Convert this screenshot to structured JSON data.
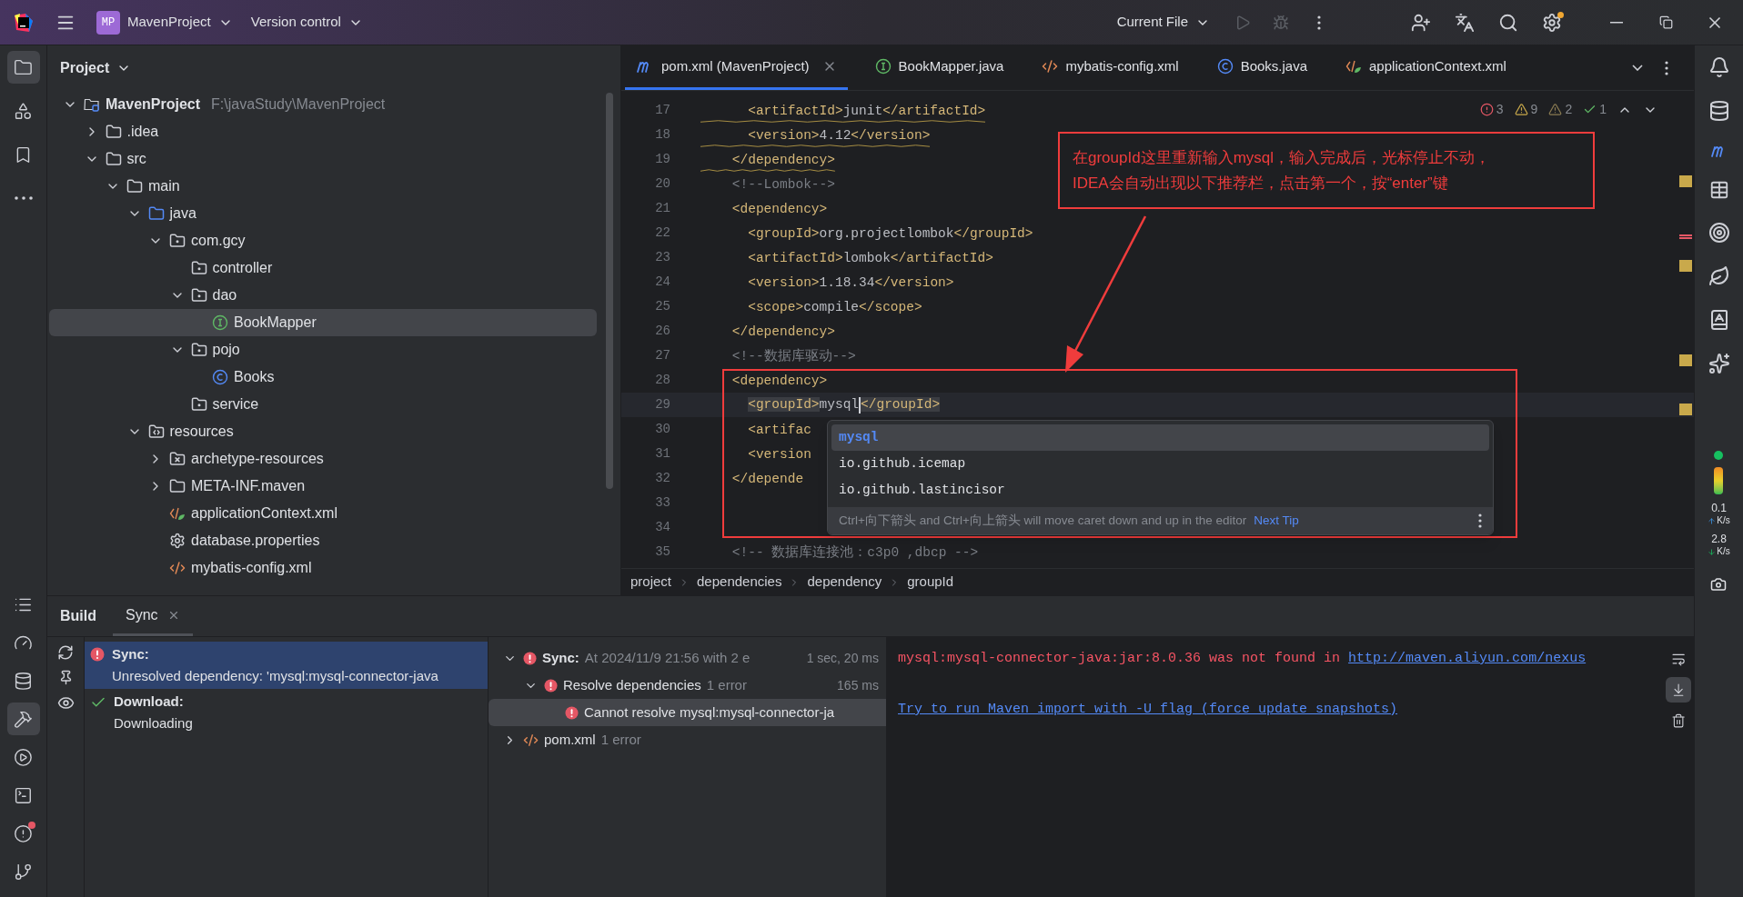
{
  "title_bar": {
    "project_badge": "MP",
    "project": "MavenProject",
    "vcs": "Version control",
    "run_config": "Current File"
  },
  "left_tools": [
    {
      "kind": "project",
      "selected": true,
      "alert": false
    },
    {
      "kind": "structure",
      "selected": false,
      "alert": false
    },
    {
      "kind": "bookmarks",
      "selected": false,
      "alert": false
    },
    {
      "kind": "more",
      "selected": false,
      "alert": false
    }
  ],
  "left_tools_bottom": [
    {
      "kind": "todo",
      "selected": false,
      "alert": false
    },
    {
      "kind": "profiler",
      "selected": false,
      "alert": false
    },
    {
      "kind": "database",
      "selected": false,
      "alert": false
    },
    {
      "kind": "build",
      "selected": true,
      "alert": false
    },
    {
      "kind": "services",
      "selected": false,
      "alert": false
    },
    {
      "kind": "terminal",
      "selected": false,
      "alert": false
    },
    {
      "kind": "problems",
      "selected": false,
      "alert": true
    },
    {
      "kind": "git",
      "selected": false,
      "alert": false
    }
  ],
  "project_panel": {
    "title": "Project",
    "tree": [
      {
        "label": "MavenProject",
        "hint": "F:\\javaStudy\\MavenProject",
        "kind": "module",
        "expanded": true,
        "selected": false,
        "children": [
          {
            "label": ".idea",
            "kind": "folder",
            "expanded": false,
            "selected": false
          },
          {
            "label": "src",
            "kind": "folder",
            "expanded": true,
            "selected": false,
            "children": [
              {
                "label": "main",
                "kind": "folder",
                "expanded": true,
                "selected": false,
                "children": [
                  {
                    "label": "java",
                    "kind": "source",
                    "expanded": true,
                    "selected": false,
                    "children": [
                      {
                        "label": "com.gcy",
                        "kind": "package",
                        "expanded": true,
                        "selected": false,
                        "children": [
                          {
                            "label": "controller",
                            "kind": "package",
                            "selected": false
                          },
                          {
                            "label": "dao",
                            "kind": "package",
                            "expanded": true,
                            "selected": false,
                            "children": [
                              {
                                "label": "BookMapper",
                                "kind": "interface",
                                "selected": true
                              }
                            ]
                          },
                          {
                            "label": "pojo",
                            "kind": "package",
                            "expanded": true,
                            "selected": false,
                            "children": [
                              {
                                "label": "Books",
                                "kind": "class",
                                "selected": false
                              }
                            ]
                          },
                          {
                            "label": "service",
                            "kind": "package",
                            "selected": false
                          }
                        ]
                      }
                    ]
                  },
                  {
                    "label": "resources",
                    "kind": "resources",
                    "expanded": true,
                    "selected": false,
                    "children": [
                      {
                        "label": "archetype-resources",
                        "kind": "template",
                        "expanded": false,
                        "selected": false
                      },
                      {
                        "label": "META-INF.maven",
                        "kind": "folder",
                        "expanded": false,
                        "selected": false
                      },
                      {
                        "label": "applicationContext.xml",
                        "kind": "spring-xml",
                        "selected": false
                      },
                      {
                        "label": "database.properties",
                        "kind": "properties",
                        "selected": false
                      },
                      {
                        "label": "mybatis-config.xml",
                        "kind": "xml",
                        "selected": false
                      }
                    ]
                  }
                ]
              }
            ]
          }
        ]
      }
    ]
  },
  "editor": {
    "tabs": [
      {
        "label": "pom.xml (MavenProject)",
        "kind": "maven",
        "selected": true,
        "closable": true
      },
      {
        "label": "BookMapper.java",
        "kind": "interface",
        "selected": false,
        "closable": false
      },
      {
        "label": "mybatis-config.xml",
        "kind": "xml",
        "selected": false,
        "closable": false
      },
      {
        "label": "Books.java",
        "kind": "class",
        "selected": false,
        "closable": false
      },
      {
        "label": "applicationContext.xml",
        "kind": "spring-xml",
        "selected": false,
        "closable": false
      }
    ],
    "inspections": [
      {
        "kind": "error",
        "count": "3"
      },
      {
        "kind": "warning",
        "count": "9"
      },
      {
        "kind": "weak",
        "count": "2"
      },
      {
        "kind": "ok",
        "count": "1"
      }
    ],
    "lines": [
      {
        "number": "17",
        "kind": "code",
        "text": "      <artifactId>junit</artifactId>",
        "warning": true,
        "current": false,
        "caret": false
      },
      {
        "number": "18",
        "kind": "code",
        "text": "      <version>4.12</version>",
        "warning": true,
        "current": false,
        "caret": false
      },
      {
        "number": "19",
        "kind": "code",
        "text": "    </dependency>",
        "warning": true,
        "current": false,
        "caret": false
      },
      {
        "number": "20",
        "kind": "comment",
        "text": "    <!--Lombok-->",
        "warning": false,
        "current": false,
        "caret": false
      },
      {
        "number": "21",
        "kind": "code",
        "text": "    <dependency>",
        "warning": false,
        "current": false,
        "caret": false
      },
      {
        "number": "22",
        "kind": "code",
        "text": "      <groupId>org.projectlombok</groupId>",
        "warning": false,
        "current": false,
        "caret": false
      },
      {
        "number": "23",
        "kind": "code",
        "text": "      <artifactId>lombok</artifactId>",
        "warning": false,
        "current": false,
        "caret": false
      },
      {
        "number": "24",
        "kind": "code",
        "text": "      <version>1.18.34</version>",
        "warning": false,
        "current": false,
        "caret": false
      },
      {
        "number": "25",
        "kind": "code",
        "text": "      <scope>compile</scope>",
        "warning": false,
        "current": false,
        "caret": false
      },
      {
        "number": "26",
        "kind": "code",
        "text": "    </dependency>",
        "warning": false,
        "current": false,
        "caret": false
      },
      {
        "number": "27",
        "kind": "comment",
        "text": "    <!--数据库驱动-->",
        "warning": false,
        "current": false,
        "caret": false
      },
      {
        "number": "28",
        "kind": "code",
        "text": "    <dependency>",
        "warning": false,
        "current": false,
        "caret": false
      },
      {
        "number": "29",
        "kind": "code",
        "text": "      <groupId>mysql</groupId>",
        "warning": false,
        "current": true,
        "caret": true
      },
      {
        "number": "30",
        "kind": "code",
        "text": "      <artifac",
        "warning": false,
        "current": false,
        "caret": false
      },
      {
        "number": "31",
        "kind": "code",
        "text": "      <version",
        "warning": false,
        "current": false,
        "caret": false
      },
      {
        "number": "32",
        "kind": "code",
        "text": "    </depende",
        "warning": false,
        "current": false,
        "caret": false
      },
      {
        "number": "33",
        "kind": "code",
        "warning": false,
        "current": false,
        "caret": false
      },
      {
        "number": "34",
        "kind": "code",
        "warning": false,
        "current": false,
        "caret": false
      },
      {
        "number": "35",
        "kind": "comment",
        "text": "    <!-- 数据库连接池：c3p0 ,dbcp -->",
        "warning": false,
        "current": false,
        "caret": false
      }
    ],
    "completion": {
      "items": [
        {
          "label": "mysql",
          "selected": true
        },
        {
          "label": "io.github.icemap",
          "selected": false
        },
        {
          "label": "io.github.lastincisor",
          "selected": false
        }
      ],
      "tip": "Ctrl+向下箭头 and Ctrl+向上箭头 will move caret down and up in the editor",
      "tip_link": "Next Tip"
    },
    "annotation": {
      "lines": [
        "在groupId这里重新输入mysql，输入完成后，光标停止不动，",
        "IDEA会自动出现以下推荐栏，点击第一个，按“enter”键"
      ]
    },
    "breadcrumbs": [
      "project",
      "dependencies",
      "dependency",
      "groupId"
    ]
  },
  "build": {
    "title": "Build",
    "tabs": [
      {
        "label": "Sync",
        "selected": true
      }
    ],
    "events": [
      {
        "kind": "error",
        "title": "Sync:",
        "detail": "Unresolved dependency: 'mysql:mysql-connector-java",
        "selected": true
      },
      {
        "kind": "success",
        "title": "Download:",
        "detail": "Downloading",
        "selected": false
      }
    ],
    "tree": [
      {
        "kind": "error",
        "label": "Sync:",
        "detail": "At 2024/11/9 21:56 with 2 e",
        "time": "1 sec, 20 ms",
        "expanded": true,
        "selected": false,
        "children": [
          {
            "kind": "error",
            "label": "Resolve dependencies",
            "detail": "1 error",
            "time": "165 ms",
            "expanded": true,
            "selected": false,
            "children": [
              {
                "kind": "error",
                "label": "Cannot resolve mysql:mysql-connector-ja",
                "selected": true
              }
            ]
          }
        ]
      },
      {
        "kind": "xml",
        "label": "pom.xml",
        "detail": "1 error",
        "expanded": false,
        "selected": false
      }
    ],
    "console": [
      {
        "kind": "error",
        "text": "mysql:mysql-connector-java:jar:8.0.36 was not found in ",
        "link": "http://maven.aliyun.com/nexus"
      },
      {
        "kind": "link",
        "text": "Try to run Maven import with -U flag (force update snapshots)"
      }
    ],
    "console_tools": [
      {
        "kind": "wrap",
        "selected": false
      },
      {
        "kind": "scroll",
        "selected": true
      },
      {
        "kind": "clear",
        "selected": false
      }
    ]
  },
  "network": {
    "up": "0.1",
    "up_unit": "K/s",
    "down": "2.8",
    "down_unit": "K/s"
  }
}
